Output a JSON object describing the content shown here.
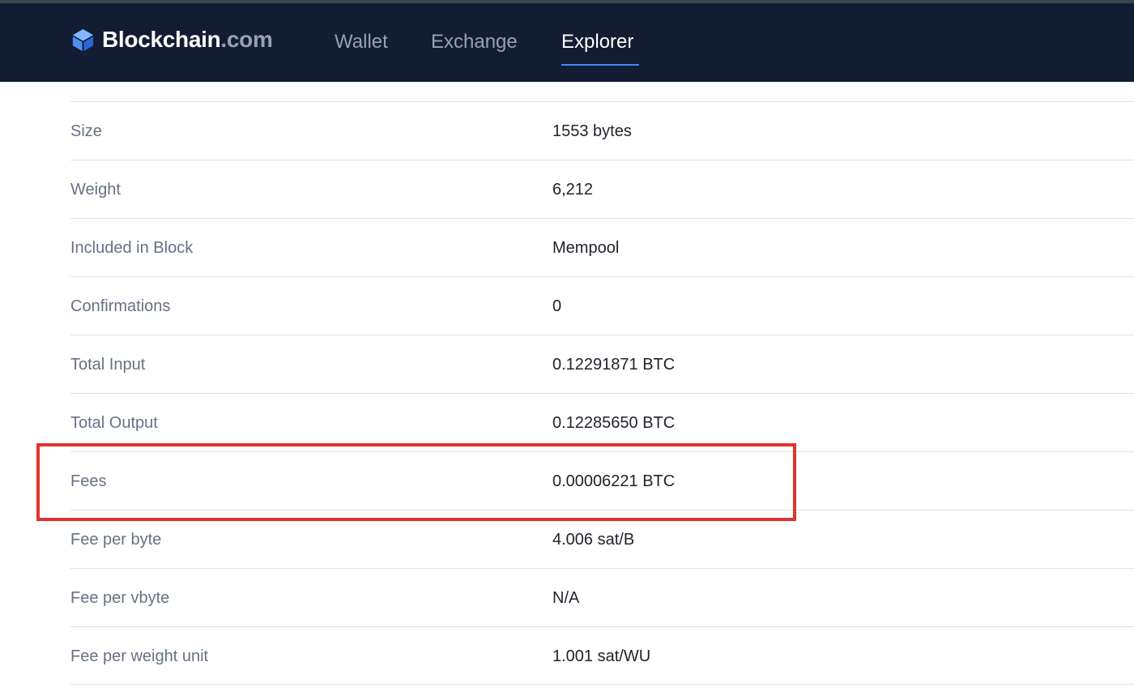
{
  "header": {
    "brand_name": "Blockchain",
    "brand_suffix": ".com",
    "logo_icon": "blockchain-cube-icon",
    "nav": [
      {
        "label": "Wallet",
        "active": false
      },
      {
        "label": "Exchange",
        "active": false
      },
      {
        "label": "Explorer",
        "active": true
      }
    ]
  },
  "details": {
    "rows": [
      {
        "label": "Size",
        "value": "1553 bytes"
      },
      {
        "label": "Weight",
        "value": "6,212"
      },
      {
        "label": "Included in Block",
        "value": "Mempool"
      },
      {
        "label": "Confirmations",
        "value": "0"
      },
      {
        "label": "Total Input",
        "value": "0.12291871 BTC"
      },
      {
        "label": "Total Output",
        "value": "0.12285650 BTC"
      },
      {
        "label": "Fees",
        "value": "0.00006221 BTC",
        "highlighted": true
      },
      {
        "label": "Fee per byte",
        "value": "4.006 sat/B"
      },
      {
        "label": "Fee per vbyte",
        "value": "N/A"
      },
      {
        "label": "Fee per weight unit",
        "value": "1.001 sat/WU"
      }
    ]
  },
  "colors": {
    "navbar_bg": "#121d33",
    "nav_active": "#ffffff",
    "nav_inactive": "#98a1b2",
    "nav_underline": "#3d89f5",
    "highlight_border": "#e0322d",
    "label_text": "#677184",
    "value_text": "#20242c"
  }
}
